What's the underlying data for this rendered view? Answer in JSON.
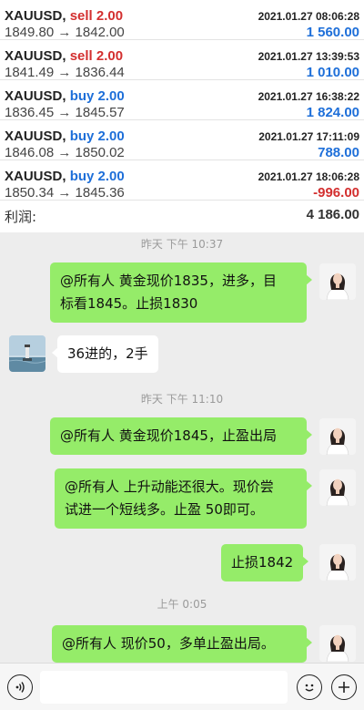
{
  "trades": [
    {
      "symbol": "XAUUSD,",
      "side": "sell 2.00",
      "side_type": "sell",
      "date": "2021.01.27 08:06:28",
      "prices": "1849.80 → 1842.00",
      "profit": "1 560.00",
      "profit_sign": "pos"
    },
    {
      "symbol": "XAUUSD,",
      "side": "sell 2.00",
      "side_type": "sell",
      "date": "2021.01.27 13:39:53",
      "prices": "1841.49 → 1836.44",
      "profit": "1 010.00",
      "profit_sign": "pos"
    },
    {
      "symbol": "XAUUSD,",
      "side": "buy 2.00",
      "side_type": "buy",
      "date": "2021.01.27 16:38:22",
      "prices": "1836.45 → 1845.57",
      "profit": "1 824.00",
      "profit_sign": "pos"
    },
    {
      "symbol": "XAUUSD,",
      "side": "buy 2.00",
      "side_type": "buy",
      "date": "2021.01.27 17:11:09",
      "prices": "1846.08 → 1850.02",
      "profit": "788.00",
      "profit_sign": "pos"
    },
    {
      "symbol": "XAUUSD,",
      "side": "buy 2.00",
      "side_type": "buy",
      "date": "2021.01.27 18:06:28",
      "prices": "1850.34 → 1845.36",
      "profit": "-996.00",
      "profit_sign": "neg"
    }
  ],
  "total": {
    "label": "利润:",
    "value": "4 186.00"
  },
  "chat": {
    "time1": "昨天 下午 10:37",
    "msg1_line1": "@所有人 黄金现价1835，进多，目",
    "msg1_line2": "标看1845。止损1830",
    "msg2": "36进的，2手",
    "time2": "昨天 下午 11:10",
    "msg3": "@所有人 黄金现价1845，止盈出局",
    "msg4_line1": "@所有人 上升动能还很大。现价尝",
    "msg4_line2": "试进一个短线多。止盈 50即可。",
    "msg5": "止损1842",
    "time3": "上午 0:05",
    "msg6": "@所有人  现价50，多单止盈出局。"
  },
  "colors": {
    "my_bubble": "#95ec69",
    "sell": "#d32f2f",
    "buy": "#1e6fd9"
  },
  "icons": {
    "voice": "voice-icon",
    "emoji": "emoji-icon",
    "plus": "plus-icon"
  }
}
